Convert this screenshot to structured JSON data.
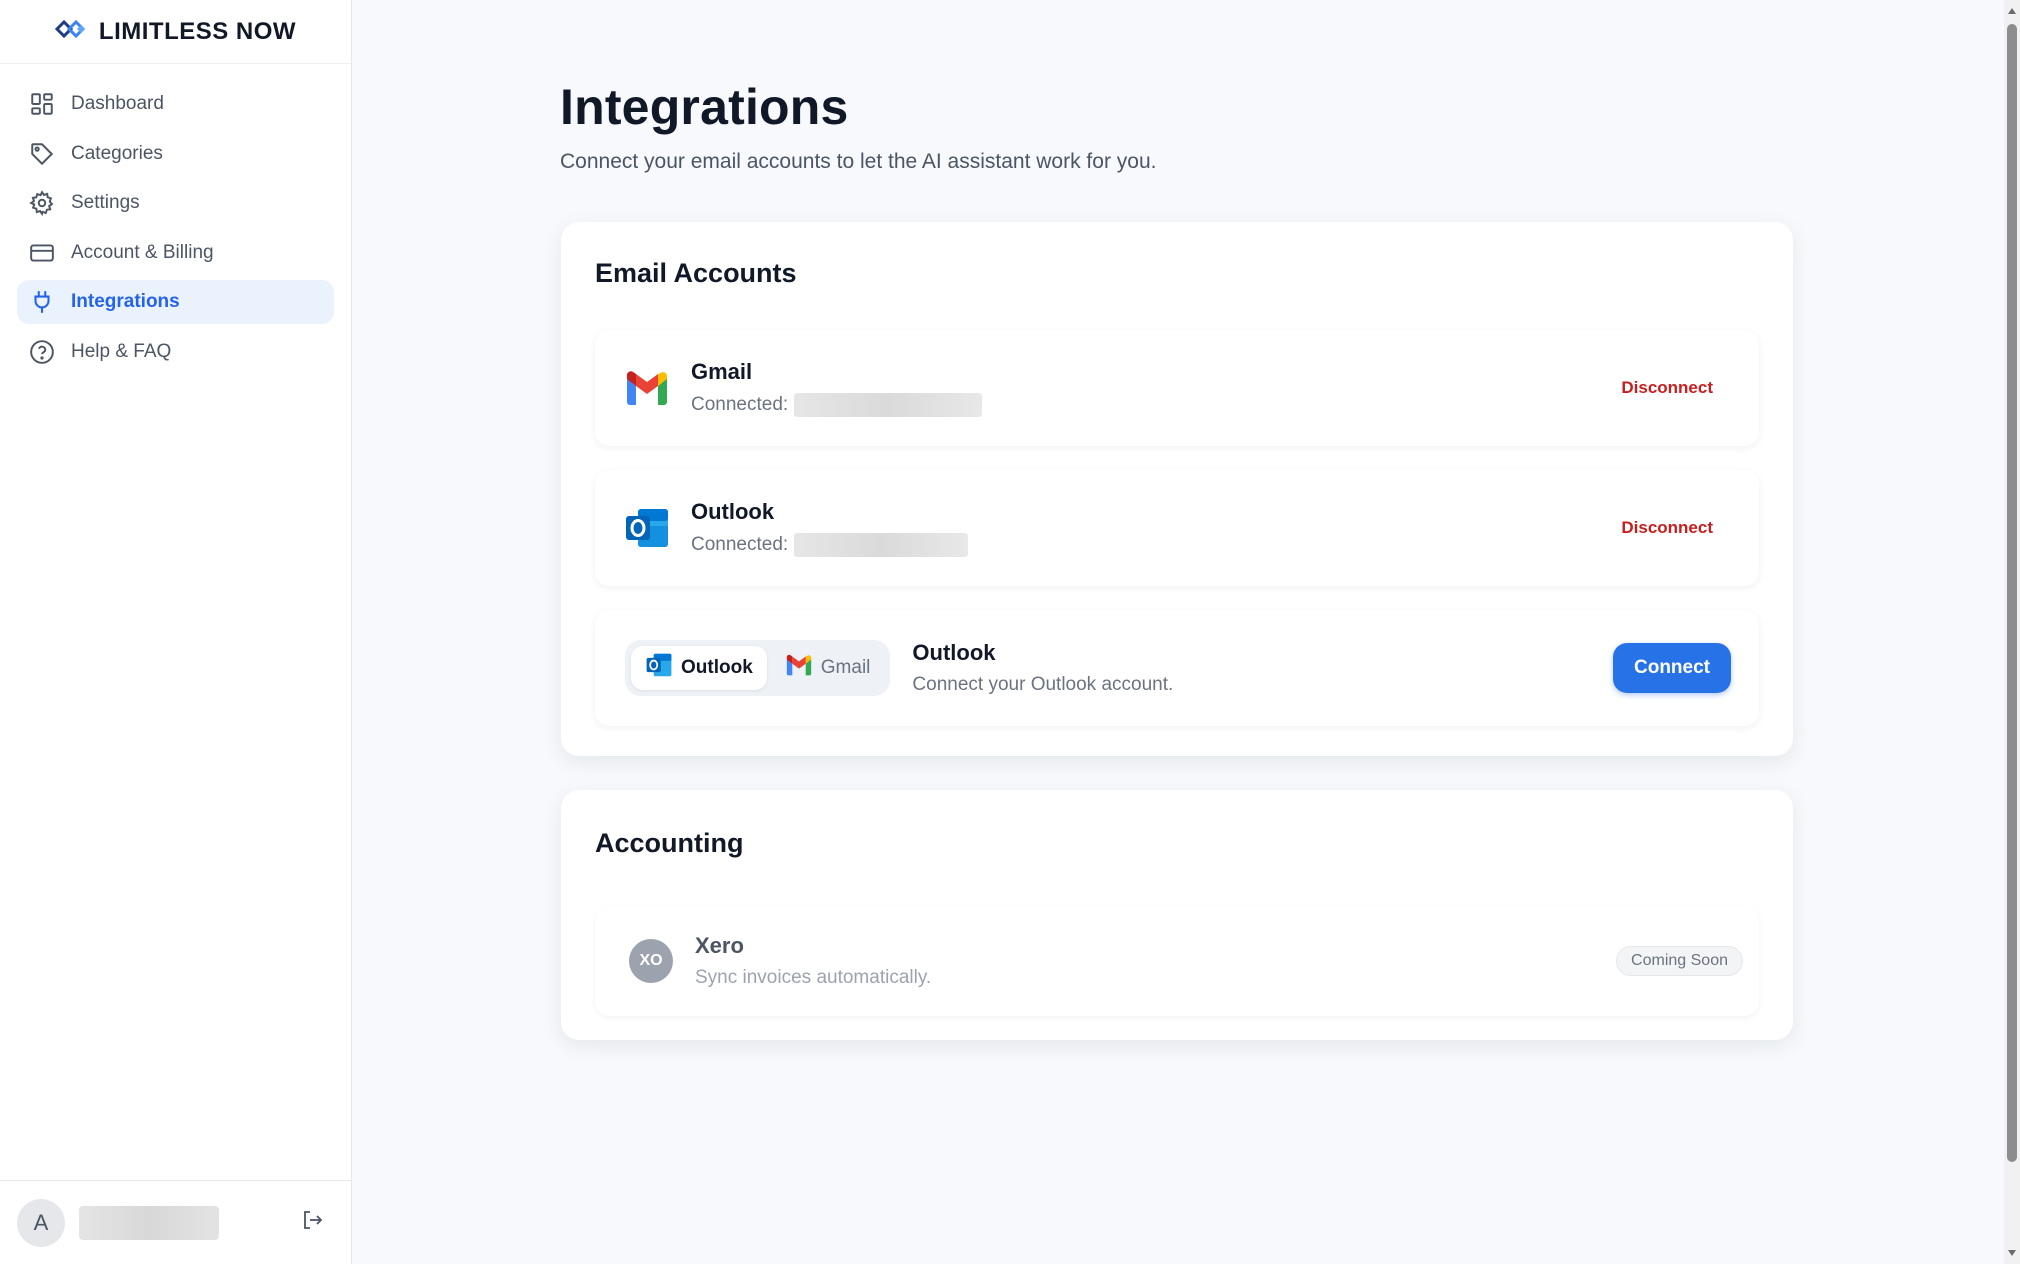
{
  "brand": {
    "name": "LIMITLESS NOW"
  },
  "sidebar": {
    "items": [
      {
        "label": "Dashboard",
        "icon": "dashboard-grid-icon"
      },
      {
        "label": "Categories",
        "icon": "tag-icon"
      },
      {
        "label": "Settings",
        "icon": "gear-icon"
      },
      {
        "label": "Account & Billing",
        "icon": "credit-card-icon"
      },
      {
        "label": "Integrations",
        "icon": "plug-icon",
        "active": true
      },
      {
        "label": "Help & FAQ",
        "icon": "help-circle-icon"
      }
    ],
    "user": {
      "initial": "A"
    }
  },
  "page": {
    "title": "Integrations",
    "subtitle": "Connect your email accounts to let the AI assistant work for you."
  },
  "email_accounts": {
    "title": "Email Accounts",
    "gmail": {
      "name": "Gmail",
      "status": "Connected:",
      "action": "Disconnect"
    },
    "outlook": {
      "name": "Outlook",
      "status": "Connected:",
      "action": "Disconnect"
    },
    "add": {
      "toggle_outlook": "Outlook",
      "toggle_gmail": "Gmail",
      "name": "Outlook",
      "description": "Connect your Outlook account.",
      "action": "Connect"
    }
  },
  "accounting": {
    "title": "Accounting",
    "xero": {
      "name": "Xero",
      "description": "Sync invoices automatically.",
      "badge": "Coming Soon",
      "logo_text": "XO"
    }
  },
  "colors": {
    "accent": "#2563eb",
    "danger": "#c81e1e",
    "active_bg": "#eaf3fd"
  }
}
